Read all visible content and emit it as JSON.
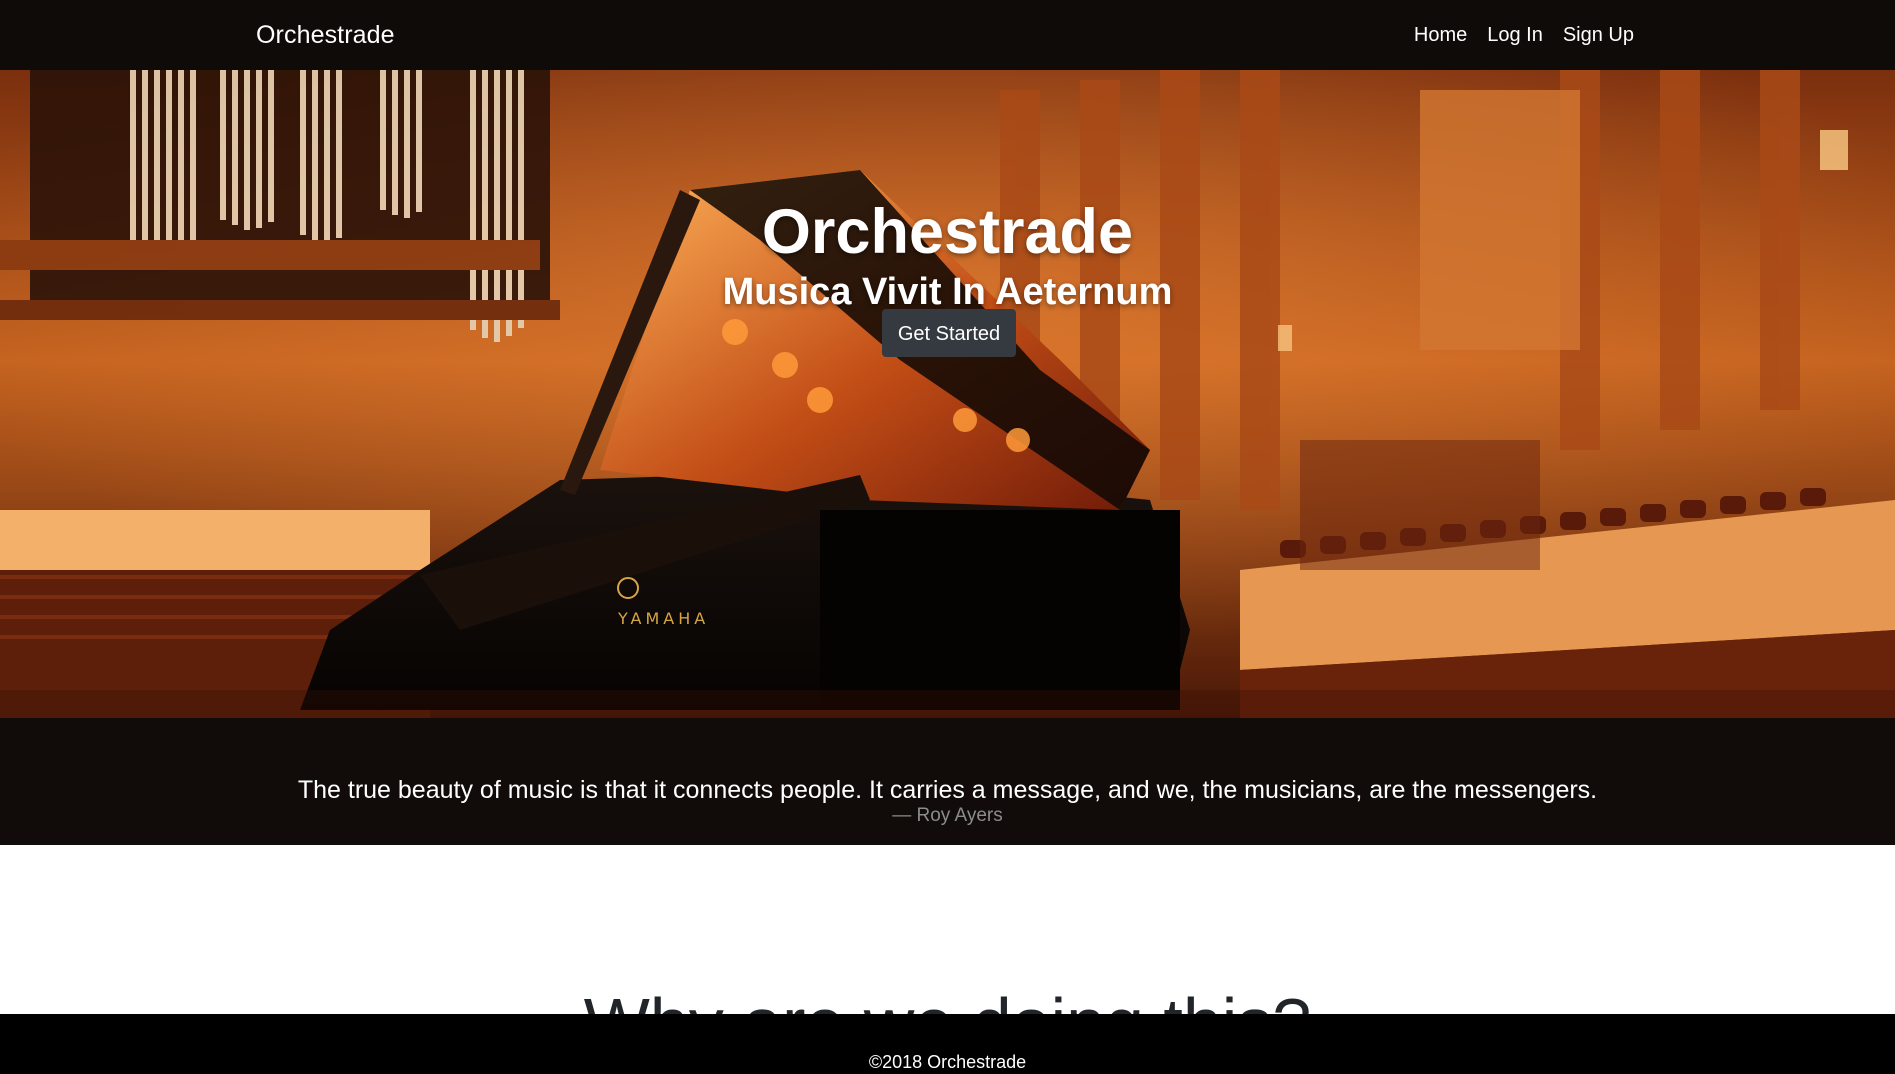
{
  "navbar": {
    "brand": "Orchestrade",
    "links": [
      "Home",
      "Log In",
      "Sign Up"
    ]
  },
  "hero": {
    "title": "Orchestrade",
    "subtitle": "Musica Vivit In Aeternum",
    "cta_label": "Get Started",
    "background_description_icon": "concert-hall-grand-piano-image",
    "piano_brand_text": "YAMAHA"
  },
  "quote": {
    "text": "The true beauty of music is that it connects people. It carries a message, and we, the musicians, are the messengers.",
    "author": "— Roy Ayers"
  },
  "why": {
    "title": "Why are we doing this?"
  },
  "footer": {
    "text": "©2018 Orchestrade"
  },
  "colors": {
    "navbar_bg": "#0f0b09",
    "quote_bg": "#110c0a",
    "footer_bg": "#000000",
    "button_bg": "#343a40",
    "hall_wood": "#c85f1c",
    "quote_author": "#8c8c8c"
  }
}
